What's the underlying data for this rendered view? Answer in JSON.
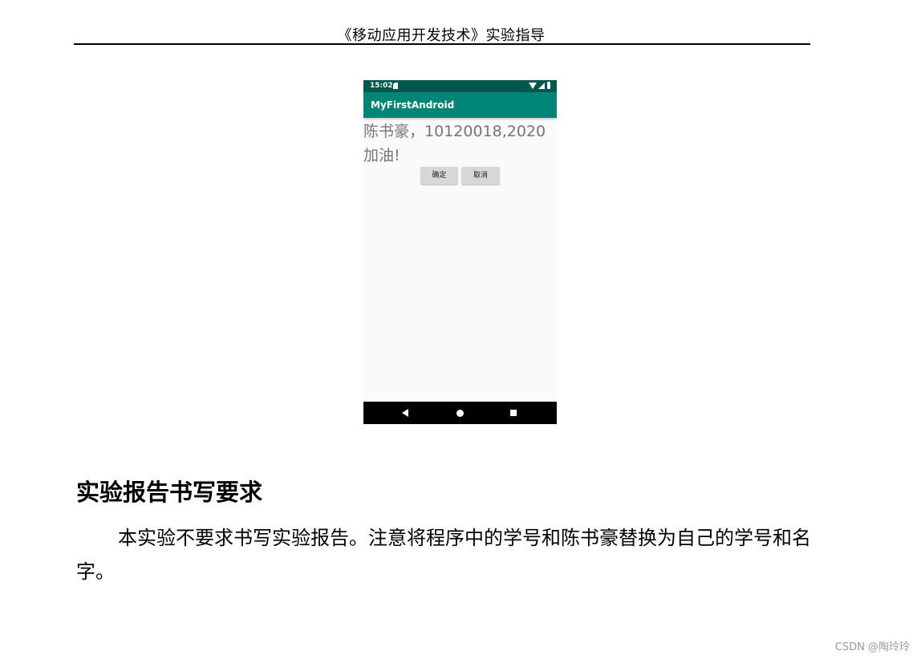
{
  "document": {
    "running_header": "《移动应用开发技术》实验指导",
    "section_heading": "实验报告书写要求",
    "body_paragraph": "本实验不要求书写实验报告。注意将程序中的学号和陈书豪替换为自己的学号和名字。"
  },
  "phone_screenshot": {
    "status_bar": {
      "time": "15:02",
      "icons": [
        "sim-card-icon",
        "wifi-icon",
        "signal-icon",
        "battery-icon"
      ]
    },
    "app_bar": {
      "title": "MyFirstAndroid"
    },
    "message_text": "陈书豪，10120018,2020加油!",
    "buttons": {
      "ok_label": "确定",
      "cancel_label": "取消"
    },
    "nav_bar": {
      "icons": [
        "back-icon",
        "home-icon",
        "recents-icon"
      ]
    },
    "colors": {
      "status_bar": "#00574b",
      "app_bar": "#008577",
      "background": "#fafafa",
      "text": "#757575",
      "button": "#d6d7d7"
    }
  },
  "watermark": "CSDN @陶玲玲"
}
